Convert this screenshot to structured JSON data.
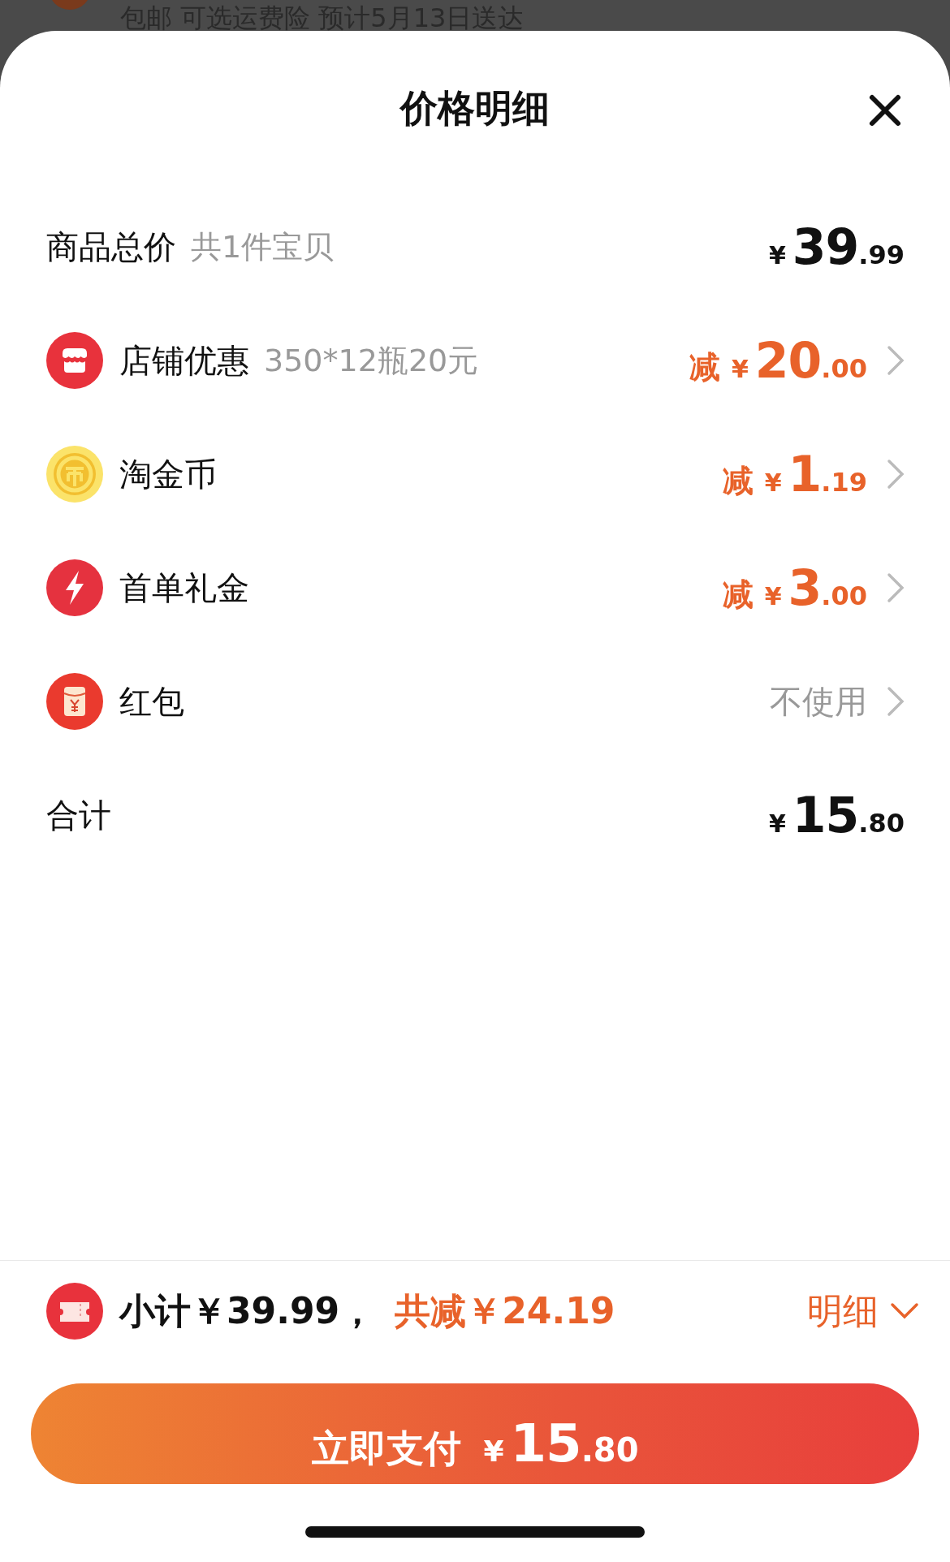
{
  "background": {
    "text": "包邮  可选运费险  预计5月13日送达"
  },
  "sheet": {
    "title": "价格明细"
  },
  "rows": [
    {
      "kind": "total",
      "label": "商品总价",
      "note": "共1件宝贝",
      "price": {
        "currency": "¥",
        "integer": "39",
        "decimal": ".99"
      }
    },
    {
      "kind": "discount",
      "label": "店铺优惠",
      "note": "350*12瓶20元",
      "price": {
        "prefix": "减",
        "currency": "¥",
        "integer": "20",
        "decimal": ".00"
      }
    },
    {
      "kind": "discount",
      "label": "淘金币",
      "price": {
        "prefix": "减",
        "currency": "¥",
        "integer": "1",
        "decimal": ".19"
      }
    },
    {
      "kind": "discount",
      "label": "首单礼金",
      "price": {
        "prefix": "减",
        "currency": "¥",
        "integer": "3",
        "decimal": ".00"
      }
    },
    {
      "kind": "option",
      "label": "红包",
      "value": "不使用"
    },
    {
      "kind": "total",
      "label": "合计",
      "price": {
        "currency": "¥",
        "integer": "15",
        "decimal": ".80"
      }
    }
  ],
  "summary": {
    "subtotal": "小计￥39.99，",
    "saved": "共减￥24.19",
    "details_link": "明细"
  },
  "pay_button": {
    "label": "立即支付",
    "currency": "¥",
    "integer": "15",
    "decimal": ".80"
  }
}
